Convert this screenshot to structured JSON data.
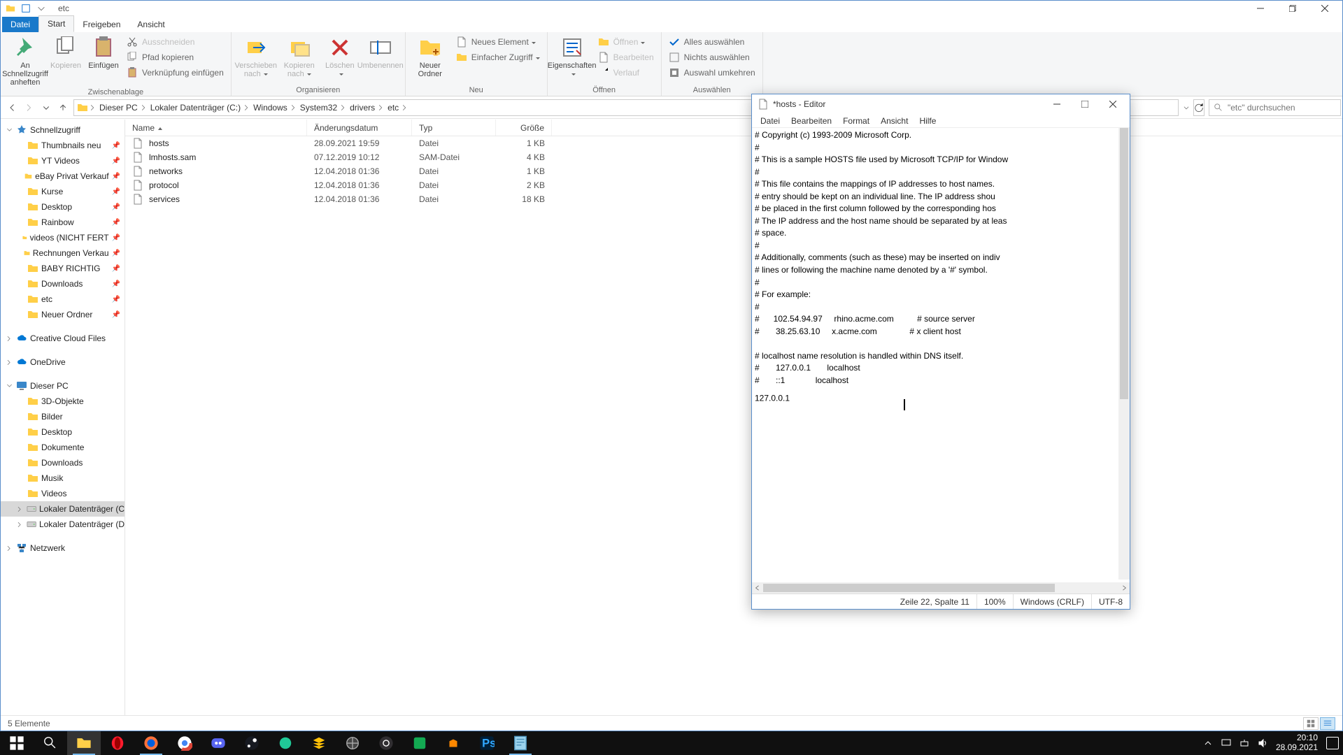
{
  "explorer": {
    "title": "etc",
    "tabs": {
      "file": "Datei",
      "start": "Start",
      "share": "Freigeben",
      "view": "Ansicht"
    },
    "ribbon": {
      "clipboard": {
        "label": "Zwischenablage",
        "pin": "An Schnellzugriff anheften",
        "copy": "Kopieren",
        "paste": "Einfügen",
        "cut": "Ausschneiden",
        "copyPath": "Pfad kopieren",
        "pasteShortcut": "Verknüpfung einfügen"
      },
      "organize": {
        "label": "Organisieren",
        "moveTo": "Verschieben nach",
        "copyTo": "Kopieren nach",
        "delete": "Löschen",
        "rename": "Umbenennen"
      },
      "new": {
        "label": "Neu",
        "newFolder": "Neuer Ordner",
        "newItem": "Neues Element",
        "easyAccess": "Einfacher Zugriff"
      },
      "open": {
        "label": "Öffnen",
        "properties": "Eigenschaften",
        "open": "Öffnen",
        "edit": "Bearbeiten",
        "history": "Verlauf"
      },
      "select": {
        "label": "Auswählen",
        "all": "Alles auswählen",
        "none": "Nichts auswählen",
        "invert": "Auswahl umkehren"
      }
    },
    "breadcrumbs": [
      "Dieser PC",
      "Lokaler Datenträger (C:)",
      "Windows",
      "System32",
      "drivers",
      "etc"
    ],
    "searchPlaceholder": "\"etc\" durchsuchen",
    "columns": {
      "name": "Name",
      "date": "Änderungsdatum",
      "type": "Typ",
      "size": "Größe"
    },
    "files": [
      {
        "name": "hosts",
        "date": "28.09.2021 19:59",
        "type": "Datei",
        "size": "1 KB"
      },
      {
        "name": "lmhosts.sam",
        "date": "07.12.2019 10:12",
        "type": "SAM-Datei",
        "size": "4 KB"
      },
      {
        "name": "networks",
        "date": "12.04.2018 01:36",
        "type": "Datei",
        "size": "1 KB"
      },
      {
        "name": "protocol",
        "date": "12.04.2018 01:36",
        "type": "Datei",
        "size": "2 KB"
      },
      {
        "name": "services",
        "date": "12.04.2018 01:36",
        "type": "Datei",
        "size": "18 KB"
      }
    ],
    "tree": {
      "quickAccess": "Schnellzugriff",
      "qa": [
        "Thumbnails neu",
        "YT Videos",
        "eBay Privat Verkauf",
        "Kurse",
        "Desktop",
        "Rainbow",
        "videos (NICHT FERT",
        "Rechnungen Verkau",
        "BABY RICHTIG",
        "Downloads",
        "etc",
        "Neuer Ordner"
      ],
      "ccf": "Creative Cloud Files",
      "onedrive": "OneDrive",
      "thispc": "Dieser PC",
      "pc": [
        "3D-Objekte",
        "Bilder",
        "Desktop",
        "Dokumente",
        "Downloads",
        "Musik",
        "Videos",
        "Lokaler Datenträger (C",
        "Lokaler Datenträger (D"
      ],
      "network": "Netzwerk"
    },
    "status": "5 Elemente"
  },
  "notepad": {
    "title": "*hosts - Editor",
    "menu": [
      "Datei",
      "Bearbeiten",
      "Format",
      "Ansicht",
      "Hilfe"
    ],
    "content": "# Copyright (c) 1993-2009 Microsoft Corp.\n#\n# This is a sample HOSTS file used by Microsoft TCP/IP for Window\n#\n# This file contains the mappings of IP addresses to host names.\n# entry should be kept on an individual line. The IP address shou\n# be placed in the first column followed by the corresponding hos\n# The IP address and the host name should be separated by at leas\n# space.\n#\n# Additionally, comments (such as these) may be inserted on indiv\n# lines or following the machine name denoted by a '#' symbol.\n#\n# For example:\n#\n#      102.54.94.97     rhino.acme.com          # source server\n#       38.25.63.10     x.acme.com              # x client host\n\n# localhost name resolution is handled within DNS itself.\n#       127.0.0.1       localhost\n#       ::1             localhost\n127.0.0.1 ",
    "status": {
      "pos": "Zeile 22, Spalte 11",
      "zoom": "100%",
      "eol": "Windows (CRLF)",
      "enc": "UTF-8"
    }
  },
  "taskbar": {
    "time": "20:10",
    "date": "28.09.2021"
  }
}
